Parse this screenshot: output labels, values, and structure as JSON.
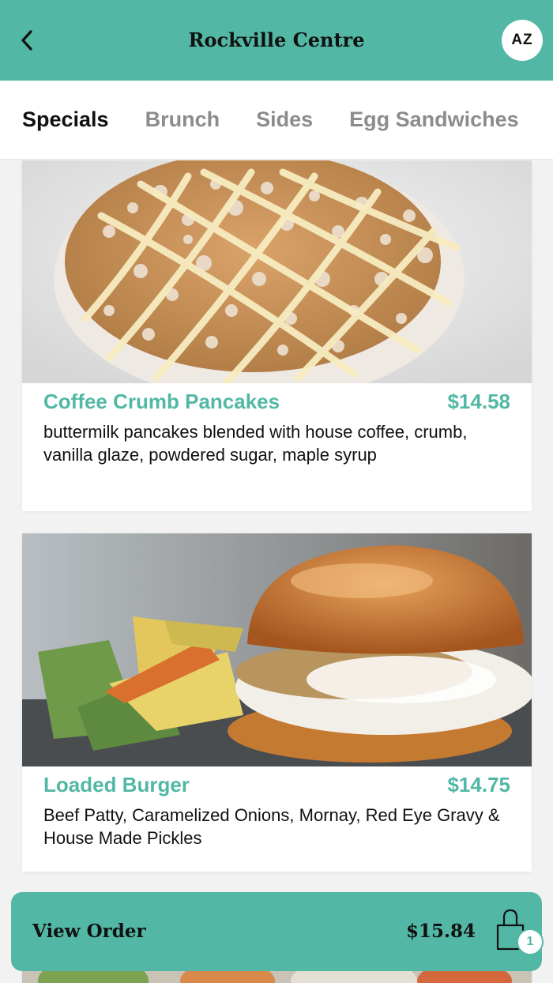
{
  "header": {
    "title": "Rockville Centre",
    "avatar_initials": "AZ",
    "back_icon": "chevron-left-icon"
  },
  "tabs": [
    {
      "label": "Specials",
      "active": true
    },
    {
      "label": "Brunch",
      "active": false
    },
    {
      "label": "Sides",
      "active": false
    },
    {
      "label": "Egg Sandwiches",
      "active": false
    }
  ],
  "items": [
    {
      "name": "Coffee Crumb Pancakes",
      "price": "$14.58",
      "description": "buttermilk pancakes blended with house coffee, crumb, vanilla glaze, powdered sugar, maple syrup"
    },
    {
      "name": "Loaded Burger",
      "price": "$14.75",
      "description": "Beef Patty, Caramelized Onions, Mornay, Red Eye Gravy & House Made Pickles"
    }
  ],
  "order_bar": {
    "label": "View Order",
    "total": "$15.84",
    "bag_icon": "shopping-bag-icon",
    "item_count": "1"
  },
  "colors": {
    "accent": "#52b8a5",
    "text": "#111111",
    "inactive_tab": "#8c8c8c"
  }
}
